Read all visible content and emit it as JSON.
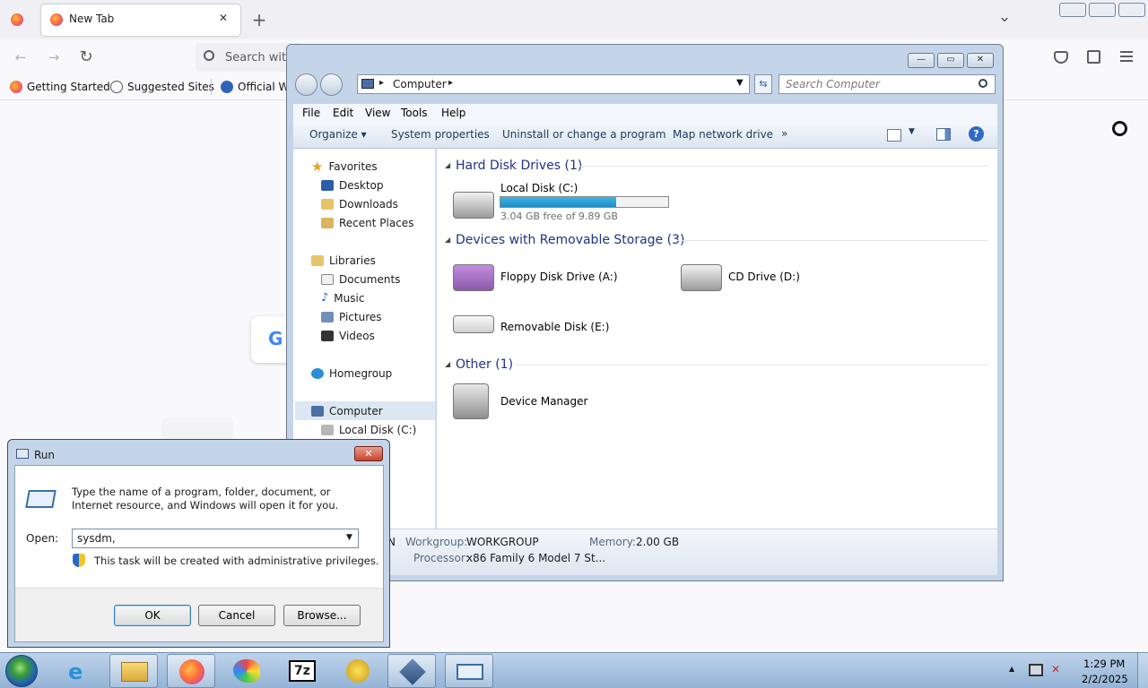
{
  "firefox": {
    "tab_title": "New Tab",
    "tab_close": "✕",
    "new_tab": "+",
    "tab_list": "⌄",
    "back": "←",
    "forward": "→",
    "reload": "↻",
    "search_placeholder": "Search with",
    "bookmarks": [
      "Getting Started",
      "Suggested Sites",
      "Official W"
    ],
    "pocket_icon": "pocket-icon",
    "extensions_icon": "puzzle-icon",
    "menu_icon": "hamburger-icon",
    "settings_icon": "gear-icon",
    "google_g": "G"
  },
  "explorer": {
    "window_buttons": {
      "minimize": "—",
      "maximize": "▭",
      "close": "✕"
    },
    "address": {
      "root": "Computer",
      "sep": "▸"
    },
    "search_placeholder": "Search Computer",
    "menu": [
      "File",
      "Edit",
      "View",
      "Tools",
      "Help"
    ],
    "commands": [
      "Organize",
      "System properties",
      "Uninstall or change a program",
      "Map network drive",
      "»"
    ],
    "nav": {
      "favorites": "Favorites",
      "favorites_items": [
        "Desktop",
        "Downloads",
        "Recent Places"
      ],
      "libraries": "Libraries",
      "libraries_items": [
        "Documents",
        "Music",
        "Pictures",
        "Videos"
      ],
      "homegroup": "Homegroup",
      "computer": "Computer",
      "computer_items": [
        "Local Disk (C:)"
      ]
    },
    "groups": {
      "hdd": "Hard Disk Drives (1)",
      "removable": "Devices with Removable Storage (3)",
      "other": "Other (1)"
    },
    "items": {
      "local_disk": "Local Disk (C:)",
      "local_disk_free": "3.04 GB free of 9.89 GB",
      "local_disk_used_fraction": 0.69,
      "floppy": "Floppy Disk Drive (A:)",
      "cd": "CD Drive (D:)",
      "removable": "Removable Disk (E:)",
      "device_manager": "Device Manager"
    },
    "details": {
      "name_fragment": "N",
      "workgroup_label": "Workgroup:",
      "workgroup": "WORKGROUP",
      "memory_label": "Memory:",
      "memory": "2.00 GB",
      "processor_label": "Processor:",
      "processor": "x86 Family 6 Model 7 St..."
    }
  },
  "run": {
    "title": "Run",
    "close": "✕",
    "description": "Type the name of a program, folder, document, or Internet resource, and Windows will open it for you.",
    "open_label": "Open:",
    "open_value": "sysdm,",
    "admin_note": "This task will be created with administrative privileges.",
    "ok": "OK",
    "cancel": "Cancel",
    "browse": "Browse..."
  },
  "taskbar": {
    "time": "1:29 PM",
    "date": "2/2/2025",
    "show_hidden": "▲",
    "colors": {
      "accent": "#26a0da",
      "brand": "#ff7139"
    }
  }
}
